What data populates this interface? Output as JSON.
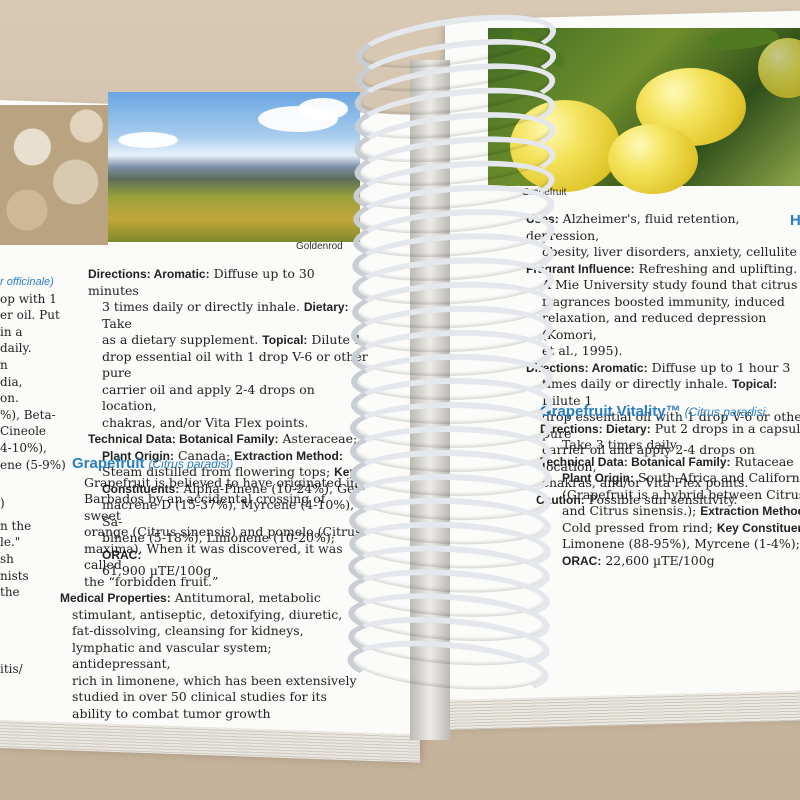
{
  "left_page": {
    "photo_caption": "Goldenrod",
    "cut_lines": [
      "r officinale)",
      "op with 1",
      "er oil. Put in a",
      "daily.",
      "n",
      "dia,",
      "on.",
      "%), Beta-",
      "Cineole",
      "4-10%),",
      "ene (5-9%)",
      ")",
      "n the",
      "le.\"",
      "sh",
      "nists",
      "the",
      "itis/"
    ],
    "col2": [
      {
        "label": "Directions: Aromatic:",
        "text": "Diffuse up to 30 minutes"
      },
      {
        "text": "3 times daily or directly inhale. ",
        "label2": "Dietary:",
        "text2": "Take"
      },
      {
        "text": "as a dietary supplement. ",
        "label2": "Topical:",
        "text2": "Dilute 1"
      },
      {
        "text": "drop essential oil with 1 drop V-6 or other pure"
      },
      {
        "text": "carrier oil and apply 2-4 drops on location,"
      },
      {
        "text": "chakras, and/or Vita Flex points."
      },
      {
        "label": "Technical Data: Botanical Family:",
        "text": "Asteraceae;"
      },
      {
        "label": "Plant Origin:",
        "text": "Canada; ",
        "label2": "Extraction Method:"
      },
      {
        "text": "Steam distilled from flowering tops; ",
        "label2": "Key"
      },
      {
        "label": "Constituents:",
        "text": "Alpha-Pinene (10-24%), Ger-"
      },
      {
        "text": "macrene D (15-37%), Myrcene (4-10%), Sa-"
      },
      {
        "text": "binene (5-18%), Limonene (10-20%); ",
        "label2": "ORAC:"
      },
      {
        "text": "61,900 µTE/100g"
      }
    ],
    "grapefruit_heading": "Grapefruit",
    "grapefruit_latin": "(Citrus paradisi)",
    "grapefruit_body": [
      "Grapefruit is believed to have originated in",
      "Barbados by an accidental crossing of sweet",
      "orange (Citrus sinensis) and pomelo (Citrus",
      "maxima). When it was discovered, it was called",
      "the “forbidden fruit.”"
    ],
    "medical_label": "Medical Properties:",
    "medical_lines": [
      "Antitumoral, metabolic",
      "stimulant, antiseptic, detoxifying, diuretic,",
      "fat-dissolving, cleansing for kidneys,",
      "lymphatic and vascular system; antidepressant,",
      "rich in limonene, which has been extensively",
      "studied in over 50 clinical studies for its",
      "ability to combat tumor growth"
    ]
  },
  "right_page": {
    "photo_caption": "Grapefruit",
    "edge_letter": "H",
    "uses_label": "Uses:",
    "uses_lines": [
      "Alzheimer's, fluid retention, depression,",
      "obesity, liver disorders, anxiety, cellulite"
    ],
    "fragrant_label": "Fragrant Influence:",
    "fragrant_lines": [
      "Refreshing and uplifting.",
      "A Mie University study found that citrus",
      "fragrances boosted immunity, induced",
      "relaxation, and reduced depression (Komori,",
      "et al., 1995)."
    ],
    "directions_label": "Directions: Aromatic:",
    "directions_lines": [
      "Diffuse up to 1 hour 3",
      "times daily or directly inhale. ",
      "drop essential oil with 1 drop V-6 or other pure",
      "carrier oil and apply 2-4 drops on location,",
      "chakras, and/or Vita Flex points."
    ],
    "topical_label": "Topical:",
    "topical_text": "Dilute 1",
    "caution_label": "Caution:",
    "caution_text": "Possible sun sensitivity.",
    "vitality_heading": "Grapefruit Vitality™",
    "vitality_latin": "(Citrus paradisi",
    "dietary_label": "Directions: Dietary:",
    "dietary_lines": [
      "Put 2 drops in a capsule",
      "Take 3 times daily."
    ],
    "tech_label": "Technical Data: Botanical Family:",
    "tech_text": "Rutaceae",
    "origin_label": "Plant Origin:",
    "origin_lines": [
      "South Africa and California",
      "(Grapefruit is a hybrid between Citrus ma",
      "and Citrus sinensis.); "
    ],
    "extraction_label": "Extraction Method",
    "rind_text": "Cold pressed from rind; ",
    "key_label": "Key Constituen",
    "limonene_text": "Limonene (88-95%), Myrcene (1-4%);",
    "orac_label": "ORAC:",
    "orac_text": "22,600 µTE/100g"
  }
}
